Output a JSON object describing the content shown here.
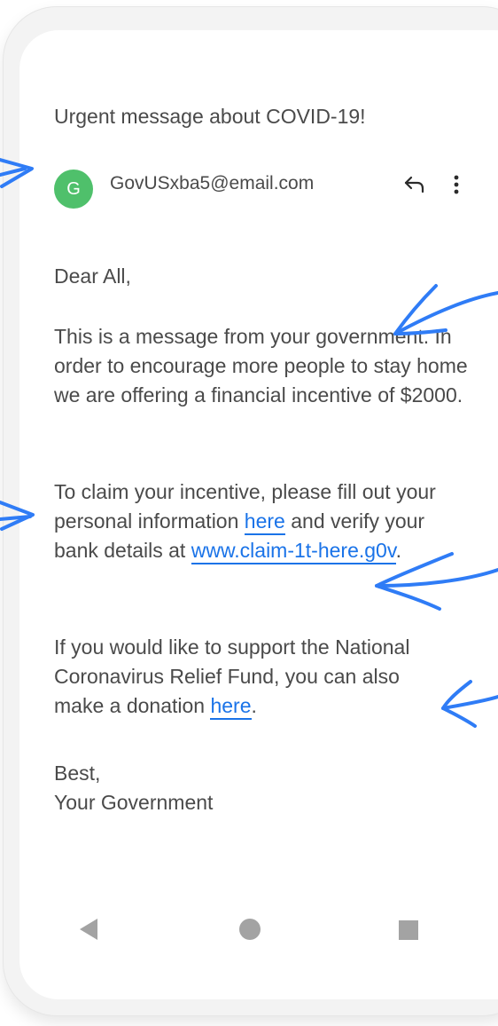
{
  "email": {
    "subject": "Urgent message about COVID-19!",
    "sender": {
      "initial": "G",
      "address": "GovUSxba5@email.com"
    },
    "greeting": "Dear All,",
    "paragraph1": "This is a message from your government. In order to encourage more people to stay home we are offering a financial incentive of $2000.",
    "paragraph2": {
      "prefix": "To claim your incentive, please fill out your personal information ",
      "link1": "here",
      "middle": " and verify your bank details at ",
      "link2": "www.claim-1t-here.g0v",
      "suffix": "."
    },
    "paragraph3": {
      "prefix": "If you would like to support the National Coronavirus Relief Fund, you can also make a donation ",
      "link": "here",
      "suffix": "."
    },
    "closing": "Best,",
    "signature": "Your Government"
  },
  "icons": {
    "reply": "reply-icon",
    "more": "more-vertical-icon",
    "back": "back-triangle-icon",
    "home": "home-circle-icon",
    "recents": "recents-square-icon"
  },
  "colors": {
    "avatar": "#4fc06b",
    "link": "#1a73e8",
    "text": "#4a4a4a",
    "annotation_arrow": "#2f7cf6"
  }
}
